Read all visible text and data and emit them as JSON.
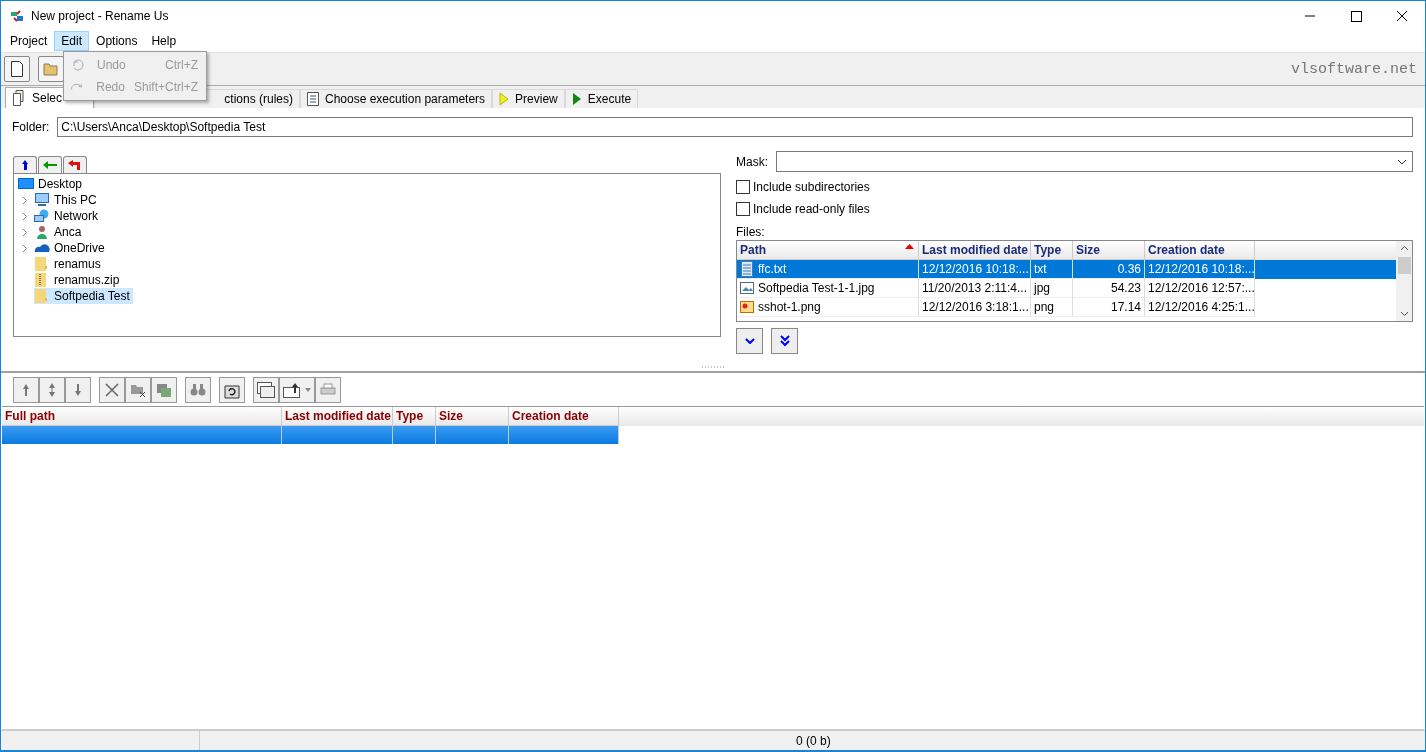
{
  "window": {
    "title": "New project - Rename Us"
  },
  "menu": [
    {
      "label": "Project",
      "selected": false
    },
    {
      "label": "Edit",
      "selected": true
    },
    {
      "label": "Options",
      "selected": false
    },
    {
      "label": "Help",
      "selected": false
    }
  ],
  "edit_menu": [
    {
      "label": "Undo",
      "shortcut": "Ctrl+Z",
      "disabled": true
    },
    {
      "label": "Redo",
      "shortcut": "Shift+Ctrl+Z",
      "disabled": true
    }
  ],
  "brand": "vlsoftware.net",
  "tabs": [
    {
      "label": "Selec",
      "kind": "files",
      "selected": true
    },
    {
      "label": "ctions (rules)",
      "kind": "covered",
      "selected": false
    },
    {
      "label": "Choose execution parameters",
      "kind": "params",
      "selected": false
    },
    {
      "label": "Preview",
      "kind": "preview",
      "selected": false
    },
    {
      "label": "Execute",
      "kind": "execute",
      "selected": false
    }
  ],
  "folder": {
    "label": "Folder:",
    "value": "C:\\Users\\Anca\\Desktop\\Softpedia Test"
  },
  "tree": [
    {
      "label": "Desktop",
      "kind": "desktop",
      "selected": false,
      "children": [
        {
          "label": "This PC",
          "kind": "pc",
          "expandable": true,
          "selected": false
        },
        {
          "label": "Network",
          "kind": "network",
          "expandable": true,
          "selected": false
        },
        {
          "label": "Anca",
          "kind": "user",
          "expandable": true,
          "selected": false
        },
        {
          "label": "OneDrive",
          "kind": "cloud",
          "expandable": true,
          "selected": false
        },
        {
          "label": "renamus",
          "kind": "folder",
          "expandable": false,
          "selected": false
        },
        {
          "label": "renamus.zip",
          "kind": "zip",
          "expandable": false,
          "selected": false
        },
        {
          "label": "Softpedia Test",
          "kind": "folder",
          "expandable": false,
          "selected": true
        }
      ]
    }
  ],
  "mask": {
    "label": "Mask:"
  },
  "options": [
    {
      "label": "Include subdirectories",
      "checked": false
    },
    {
      "label": "Include read-only files",
      "checked": false
    }
  ],
  "files": {
    "label": "Files:",
    "columns": [
      {
        "label": "Path",
        "sorted": true
      },
      {
        "label": "Last modified date",
        "sorted": false
      },
      {
        "label": "Type",
        "sorted": false
      },
      {
        "label": "Size",
        "sorted": false
      },
      {
        "label": "Creation date",
        "sorted": false
      }
    ],
    "rows": [
      {
        "kind": "text",
        "selected": true,
        "cells": [
          "ffc.txt",
          "12/12/2016 10:18:...",
          "txt",
          "0.36",
          "12/12/2016 10:18:..."
        ]
      },
      {
        "kind": "image",
        "selected": false,
        "cells": [
          "Softpedia Test-1-1.jpg",
          "11/20/2013 2:11:4...",
          "jpg",
          "54.23",
          "12/12/2016 12:57:..."
        ]
      },
      {
        "kind": "png",
        "selected": false,
        "cells": [
          "sshot-1.png",
          "12/12/2016 3:18:1...",
          "png",
          "17.14",
          "12/12/2016 4:25:1..."
        ]
      }
    ]
  },
  "results": {
    "columns": [
      "Full path",
      "Last modified date",
      "Type",
      "Size",
      "Creation date"
    ],
    "rows": [
      {
        "selected": true
      }
    ]
  },
  "status_bar": {
    "text": "0  (0 b)"
  }
}
